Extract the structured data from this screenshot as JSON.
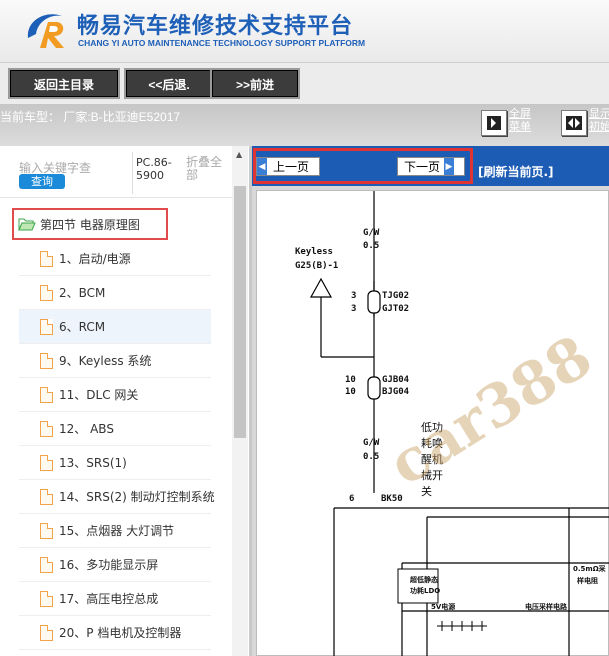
{
  "header": {
    "title_cn": "畅易汽车维修技术支持平台",
    "title_en": "CHANG YI AUTO MAINTENANCE TECHNOLOGY SUPPORT PLATFORM",
    "brand_color": "#1e5fb8"
  },
  "toolbar": {
    "home_label": "返回主目录",
    "back_label": "<<后退.",
    "forward_label": ">>前进"
  },
  "carline": {
    "current_model": "当前车型： 厂家:B-比亚迪E52017",
    "fullscreen_label_1": "全屏",
    "fullscreen_label_2": "菜单",
    "restore_label_1": "显示",
    "restore_label_2": "初始"
  },
  "sidebar": {
    "search_placeholder": "输入关键字查",
    "search_button": "查询",
    "pc_line1": "PC.86-",
    "pc_line2": "5900",
    "fold_line1": "折叠全",
    "fold_line2": "部",
    "section_label": "第四节 电器原理图",
    "items": [
      {
        "label": "1、启动/电源"
      },
      {
        "label": "2、BCM"
      },
      {
        "label": "6、RCM",
        "selected": true
      },
      {
        "label": "9、Keyless 系统"
      },
      {
        "label": "11、DLC 网关"
      },
      {
        "label": "12、 ABS"
      },
      {
        "label": "13、SRS(1)"
      },
      {
        "label": "14、SRS(2) 制动灯控制系统"
      },
      {
        "label": "15、点烟器 大灯调节"
      },
      {
        "label": "16、多功能显示屏"
      },
      {
        "label": "17、高压电控总成"
      },
      {
        "label": "20、P 档电机及控制器"
      }
    ]
  },
  "viewer": {
    "prev_label": "上一页",
    "next_label": "下一页",
    "refresh_label": "[刷新当前页.]",
    "watermark": "car388",
    "diagram": {
      "wire_top": "G/W",
      "wire_top_size": "0.5",
      "keyless_label": "Keyless",
      "keyless_pin": "G25(B)-1",
      "conn_a_num_1": "3",
      "conn_a_num_2": "3",
      "conn_a_1": "TJG02",
      "conn_a_2": "GJT02",
      "conn_b_num_1": "10",
      "conn_b_num_2": "10",
      "conn_b_1": "GJB04",
      "conn_b_2": "BJG04",
      "wire_mid": "G/W",
      "wire_mid_size": "0.5",
      "low_power_1": "低功",
      "low_power_2": "耗唤",
      "low_power_3": "醒机",
      "low_power_4": "械开",
      "low_power_5": "关",
      "conn_c_num": "6",
      "conn_c": "BK50",
      "ldo_1": "超低静态",
      "ldo_2": "功耗LDO",
      "sv_label": "5V电源",
      "res_1": "0.5mΩ采",
      "res_2": "样电阻",
      "volt_label": "电压采样电路"
    }
  }
}
